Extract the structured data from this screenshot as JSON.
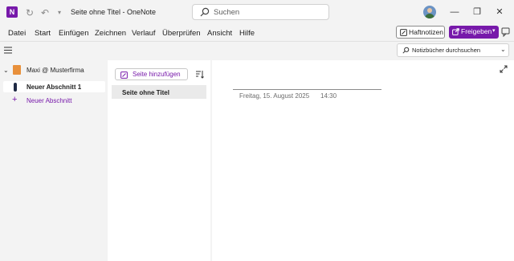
{
  "titlebar": {
    "app_icon_label": "N",
    "window_title": "Seite ohne Titel  -  OneNote",
    "search_placeholder": "Suchen"
  },
  "menu": {
    "items": [
      "Datei",
      "Start",
      "Einfügen",
      "Zeichnen",
      "Verlauf",
      "Überprüfen",
      "Ansicht",
      "Hilfe"
    ],
    "haftnotizen_label": "Haftnotizen",
    "freigeben_label": "Freigeben"
  },
  "toolbar2": {
    "notebook_search_label": "Notizbücher durchsuchen"
  },
  "notebooks": {
    "current_notebook": "Maxi @ Musterfirma",
    "sections": [
      {
        "label": "Neuer Abschnitt 1",
        "active": true
      }
    ],
    "add_section_label": "Neuer Abschnitt"
  },
  "pages": {
    "add_page_label": "Seite hinzufügen",
    "items": [
      {
        "label": "Seite ohne Titel",
        "active": true
      }
    ]
  },
  "note": {
    "date": "Freitag, 15. August 2025",
    "time": "14:30"
  },
  "colors": {
    "brand": "#7719aa",
    "section_accent": "#1f2a44",
    "notebook_icon": "#e8903b"
  }
}
